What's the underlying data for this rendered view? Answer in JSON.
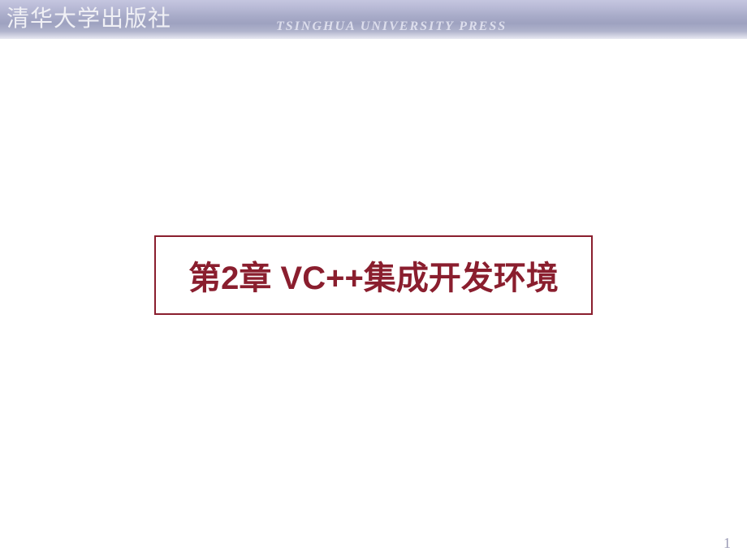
{
  "header": {
    "publisher_cn": "清华大学出版社",
    "publisher_en": "TSINGHUA UNIVERSITY PRESS"
  },
  "main": {
    "chapter_title": "第2章 VC++集成开发环境"
  },
  "footer": {
    "page_number": "1"
  }
}
